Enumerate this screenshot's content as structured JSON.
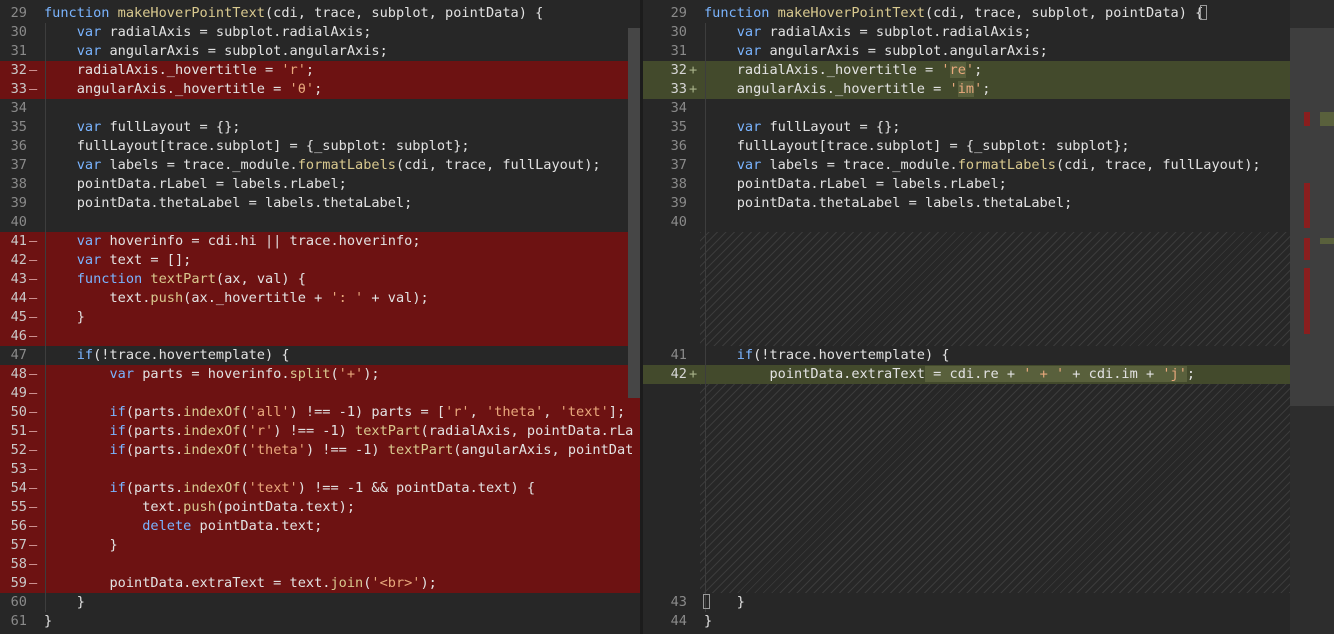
{
  "colors": {
    "background": "#272727",
    "deleted_line": "#6d1212",
    "added_line": "#434a2c",
    "keyword": "#7ab4ff",
    "function_name": "#d9c98f",
    "string": "#e8a87c"
  },
  "left_pane": {
    "lines": [
      {
        "num": "29",
        "mark": "",
        "type": "normal",
        "tokens": [
          [
            "kw",
            "function "
          ],
          [
            "fn",
            "makeHoverPointText"
          ],
          [
            "p",
            "(cdi, trace, subplot, pointData) {"
          ]
        ]
      },
      {
        "num": "30",
        "mark": "",
        "type": "normal",
        "tokens": [
          [
            "p",
            "    "
          ],
          [
            "kw",
            "var "
          ],
          [
            "p",
            "radialAxis = subplot.radialAxis;"
          ]
        ]
      },
      {
        "num": "31",
        "mark": "",
        "type": "normal",
        "tokens": [
          [
            "p",
            "    "
          ],
          [
            "kw",
            "var "
          ],
          [
            "p",
            "angularAxis = subplot.angularAxis;"
          ]
        ]
      },
      {
        "num": "32",
        "mark": "—",
        "type": "del",
        "tokens": [
          [
            "p",
            "    radialAxis._hovertitle = "
          ],
          [
            "str",
            "'r'"
          ],
          [
            "p",
            ";"
          ]
        ]
      },
      {
        "num": "33",
        "mark": "—",
        "type": "del",
        "tokens": [
          [
            "p",
            "    angularAxis._hovertitle = "
          ],
          [
            "str",
            "'θ'"
          ],
          [
            "p",
            ";"
          ]
        ]
      },
      {
        "num": "34",
        "mark": "",
        "type": "normal",
        "tokens": []
      },
      {
        "num": "35",
        "mark": "",
        "type": "normal",
        "tokens": [
          [
            "p",
            "    "
          ],
          [
            "kw",
            "var "
          ],
          [
            "p",
            "fullLayout = {};"
          ]
        ]
      },
      {
        "num": "36",
        "mark": "",
        "type": "normal",
        "tokens": [
          [
            "p",
            "    fullLayout[trace.subplot] = {_subplot: subplot};"
          ]
        ]
      },
      {
        "num": "37",
        "mark": "",
        "type": "normal",
        "tokens": [
          [
            "p",
            "    "
          ],
          [
            "kw",
            "var "
          ],
          [
            "p",
            "labels = trace._module."
          ],
          [
            "fn",
            "formatLabels"
          ],
          [
            "p",
            "(cdi, trace, fullLayout);"
          ]
        ]
      },
      {
        "num": "38",
        "mark": "",
        "type": "normal",
        "tokens": [
          [
            "p",
            "    pointData.rLabel = labels.rLabel;"
          ]
        ]
      },
      {
        "num": "39",
        "mark": "",
        "type": "normal",
        "tokens": [
          [
            "p",
            "    pointData.thetaLabel = labels.thetaLabel;"
          ]
        ]
      },
      {
        "num": "40",
        "mark": "",
        "type": "normal",
        "tokens": []
      },
      {
        "num": "41",
        "mark": "—",
        "type": "del",
        "tokens": [
          [
            "p",
            "    "
          ],
          [
            "kw",
            "var "
          ],
          [
            "p",
            "hoverinfo = cdi.hi || trace.hoverinfo;"
          ]
        ]
      },
      {
        "num": "42",
        "mark": "—",
        "type": "del",
        "tokens": [
          [
            "p",
            "    "
          ],
          [
            "kw",
            "var "
          ],
          [
            "p",
            "text = [];"
          ]
        ]
      },
      {
        "num": "43",
        "mark": "—",
        "type": "del",
        "tokens": [
          [
            "p",
            "    "
          ],
          [
            "kw",
            "function "
          ],
          [
            "fn",
            "textPart"
          ],
          [
            "p",
            "(ax, val) {"
          ]
        ]
      },
      {
        "num": "44",
        "mark": "—",
        "type": "del",
        "tokens": [
          [
            "p",
            "        text."
          ],
          [
            "fn",
            "push"
          ],
          [
            "p",
            "(ax._hovertitle + "
          ],
          [
            "str",
            "': '"
          ],
          [
            "p",
            " + val);"
          ]
        ]
      },
      {
        "num": "45",
        "mark": "—",
        "type": "del",
        "tokens": [
          [
            "p",
            "    }"
          ]
        ]
      },
      {
        "num": "46",
        "mark": "—",
        "type": "del",
        "tokens": []
      },
      {
        "num": "47",
        "mark": "",
        "type": "normal",
        "tokens": [
          [
            "p",
            "    "
          ],
          [
            "kw",
            "if"
          ],
          [
            "p",
            "(!trace.hovertemplate) {"
          ]
        ]
      },
      {
        "num": "48",
        "mark": "—",
        "type": "del",
        "tokens": [
          [
            "p",
            "        "
          ],
          [
            "kw",
            "var "
          ],
          [
            "p",
            "parts = hoverinfo."
          ],
          [
            "fn",
            "split"
          ],
          [
            "p",
            "("
          ],
          [
            "str",
            "'+'"
          ],
          [
            "p",
            ");"
          ]
        ]
      },
      {
        "num": "49",
        "mark": "—",
        "type": "del",
        "tokens": []
      },
      {
        "num": "50",
        "mark": "—",
        "type": "del",
        "tokens": [
          [
            "p",
            "        "
          ],
          [
            "kw",
            "if"
          ],
          [
            "p",
            "(parts."
          ],
          [
            "fn",
            "indexOf"
          ],
          [
            "p",
            "("
          ],
          [
            "str",
            "'all'"
          ],
          [
            "p",
            ") !== -1) parts = ["
          ],
          [
            "str",
            "'r'"
          ],
          [
            "p",
            ", "
          ],
          [
            "str",
            "'theta'"
          ],
          [
            "p",
            ", "
          ],
          [
            "str",
            "'text'"
          ],
          [
            "p",
            "];"
          ]
        ]
      },
      {
        "num": "51",
        "mark": "—",
        "type": "del",
        "tokens": [
          [
            "p",
            "        "
          ],
          [
            "kw",
            "if"
          ],
          [
            "p",
            "(parts."
          ],
          [
            "fn",
            "indexOf"
          ],
          [
            "p",
            "("
          ],
          [
            "str",
            "'r'"
          ],
          [
            "p",
            ") !== -1) "
          ],
          [
            "fn",
            "textPart"
          ],
          [
            "p",
            "(radialAxis, pointData.rLa"
          ]
        ]
      },
      {
        "num": "52",
        "mark": "—",
        "type": "del",
        "tokens": [
          [
            "p",
            "        "
          ],
          [
            "kw",
            "if"
          ],
          [
            "p",
            "(parts."
          ],
          [
            "fn",
            "indexOf"
          ],
          [
            "p",
            "("
          ],
          [
            "str",
            "'theta'"
          ],
          [
            "p",
            ") !== -1) "
          ],
          [
            "fn",
            "textPart"
          ],
          [
            "p",
            "(angularAxis, pointDat"
          ]
        ]
      },
      {
        "num": "53",
        "mark": "—",
        "type": "del",
        "tokens": []
      },
      {
        "num": "54",
        "mark": "—",
        "type": "del",
        "tokens": [
          [
            "p",
            "        "
          ],
          [
            "kw",
            "if"
          ],
          [
            "p",
            "(parts."
          ],
          [
            "fn",
            "indexOf"
          ],
          [
            "p",
            "("
          ],
          [
            "str",
            "'text'"
          ],
          [
            "p",
            ") !== -1 && pointData.text) {"
          ]
        ]
      },
      {
        "num": "55",
        "mark": "—",
        "type": "del",
        "tokens": [
          [
            "p",
            "            text."
          ],
          [
            "fn",
            "push"
          ],
          [
            "p",
            "(pointData.text);"
          ]
        ]
      },
      {
        "num": "56",
        "mark": "—",
        "type": "del",
        "tokens": [
          [
            "p",
            "            "
          ],
          [
            "kw",
            "delete "
          ],
          [
            "p",
            "pointData.text;"
          ]
        ]
      },
      {
        "num": "57",
        "mark": "—",
        "type": "del",
        "tokens": [
          [
            "p",
            "        }"
          ]
        ]
      },
      {
        "num": "58",
        "mark": "—",
        "type": "del",
        "tokens": []
      },
      {
        "num": "59",
        "mark": "—",
        "type": "del",
        "tokens": [
          [
            "p",
            "        pointData.extraText = text."
          ],
          [
            "fn",
            "join"
          ],
          [
            "p",
            "("
          ],
          [
            "str",
            "'<br>'"
          ],
          [
            "p",
            ");"
          ]
        ]
      },
      {
        "num": "60",
        "mark": "",
        "type": "normal",
        "tokens": [
          [
            "p",
            "    }"
          ]
        ]
      },
      {
        "num": "61",
        "mark": "",
        "type": "normal",
        "tokens": [
          [
            "p",
            "}"
          ]
        ]
      }
    ]
  },
  "right_pane": {
    "lines": [
      {
        "num": "29",
        "mark": "",
        "type": "normal",
        "tokens": [
          [
            "kw",
            "function "
          ],
          [
            "fn",
            "makeHoverPointText"
          ],
          [
            "p",
            "(cdi, trace, subplot, pointData) {"
          ]
        ]
      },
      {
        "num": "30",
        "mark": "",
        "type": "normal",
        "tokens": [
          [
            "p",
            "    "
          ],
          [
            "kw",
            "var "
          ],
          [
            "p",
            "radialAxis = subplot.radialAxis;"
          ]
        ]
      },
      {
        "num": "31",
        "mark": "",
        "type": "normal",
        "tokens": [
          [
            "p",
            "    "
          ],
          [
            "kw",
            "var "
          ],
          [
            "p",
            "angularAxis = subplot.angularAxis;"
          ]
        ]
      },
      {
        "num": "32",
        "mark": "+",
        "type": "add",
        "tokens": [
          [
            "p",
            "    radialAxis._hovertitle = "
          ],
          [
            "str",
            "'"
          ],
          [
            "hlstr",
            "re"
          ],
          [
            "str",
            "'"
          ],
          [
            "p",
            ";"
          ]
        ]
      },
      {
        "num": "33",
        "mark": "+",
        "type": "add",
        "tokens": [
          [
            "p",
            "    angularAxis._hovertitle = "
          ],
          [
            "str",
            "'"
          ],
          [
            "hlstr",
            "im"
          ],
          [
            "str",
            "'"
          ],
          [
            "p",
            ";"
          ]
        ]
      },
      {
        "num": "34",
        "mark": "",
        "type": "normal",
        "tokens": []
      },
      {
        "num": "35",
        "mark": "",
        "type": "normal",
        "tokens": [
          [
            "p",
            "    "
          ],
          [
            "kw",
            "var "
          ],
          [
            "p",
            "fullLayout = {};"
          ]
        ]
      },
      {
        "num": "36",
        "mark": "",
        "type": "normal",
        "tokens": [
          [
            "p",
            "    fullLayout[trace.subplot] = {_subplot: subplot};"
          ]
        ]
      },
      {
        "num": "37",
        "mark": "",
        "type": "normal",
        "tokens": [
          [
            "p",
            "    "
          ],
          [
            "kw",
            "var "
          ],
          [
            "p",
            "labels = trace._module."
          ],
          [
            "fn",
            "formatLabels"
          ],
          [
            "p",
            "(cdi, trace, fullLayout);"
          ]
        ]
      },
      {
        "num": "38",
        "mark": "",
        "type": "normal",
        "tokens": [
          [
            "p",
            "    pointData.rLabel = labels.rLabel;"
          ]
        ]
      },
      {
        "num": "39",
        "mark": "",
        "type": "normal",
        "tokens": [
          [
            "p",
            "    pointData.thetaLabel = labels.thetaLabel;"
          ]
        ]
      },
      {
        "num": "40",
        "mark": "",
        "type": "normal",
        "tokens": []
      },
      {
        "gap": 6
      },
      {
        "num": "41",
        "mark": "",
        "type": "normal",
        "tokens": [
          [
            "p",
            "    "
          ],
          [
            "kw",
            "if"
          ],
          [
            "p",
            "(!trace.hovertemplate) {"
          ]
        ]
      },
      {
        "num": "42",
        "mark": "+",
        "type": "add",
        "tokens": [
          [
            "p",
            "        pointData.extraText"
          ],
          [
            "hl",
            " = cdi.re + "
          ],
          [
            "hlstr",
            "' + '"
          ],
          [
            "hl",
            " + cdi.im + "
          ],
          [
            "hlstr",
            "'j'"
          ],
          [
            "p",
            ";"
          ]
        ]
      },
      {
        "gap": 11
      },
      {
        "num": "43",
        "mark": "",
        "type": "normal",
        "tokens": [
          [
            "p",
            "    }"
          ]
        ]
      },
      {
        "num": "44",
        "mark": "",
        "type": "normal",
        "tokens": [
          [
            "p",
            "}"
          ]
        ]
      }
    ]
  }
}
